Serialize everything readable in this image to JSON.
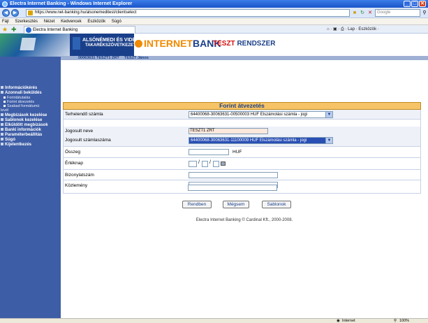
{
  "window": {
    "title": "Electra Internet Banking - Windows Internet Explorer",
    "minimize": "_",
    "maximize": "□",
    "close": "✕"
  },
  "browser": {
    "url": "https://www.net-banking.hu/alsonemeditest/clientselect",
    "search_placeholder": "Google",
    "menu": [
      "Fájl",
      "Szerkesztés",
      "Nézet",
      "Kedvencek",
      "Eszközök",
      "Súgó"
    ],
    "tab_title": "Electra Internet Banking",
    "tools": "⌂ · ▣ · ⎙ · Lap · Eszközök ·"
  },
  "bank": {
    "name_line1": "ALSÓNÉMEDI ÉS VIDÉKE",
    "name_line2": "TAKARÉKSZÖVETKEZET",
    "internet": "INTERNET",
    "bank_word": "BANK",
    "teszt": "TESZT",
    "rendszer": "RENDSZER",
    "account_strip": "00063631  TESZT1 ZRT",
    "user_strip": "TESZT János"
  },
  "sidebar": {
    "items": [
      {
        "label": "Információkérés",
        "bold": true
      },
      {
        "label": "Azonnali beküldés",
        "bold": true
      },
      {
        "label": "Forintátutalás",
        "bold": false,
        "sub": true
      },
      {
        "label": "Forint átvezetés",
        "bold": false,
        "sub": true
      },
      {
        "label": "Szabad formátumú",
        "bold": false,
        "sub": true
      },
      {
        "label": "levél",
        "bold": false,
        "sub": true,
        "cont": true
      },
      {
        "label": "Megbízások kezelése",
        "bold": true
      },
      {
        "label": "Sablonok kezelése",
        "bold": true
      },
      {
        "label": "Elküldött megbízások",
        "bold": true
      },
      {
        "label": "Banki információk",
        "bold": true
      },
      {
        "label": "Paraméterbeállítás",
        "bold": true
      },
      {
        "label": "Súgó",
        "bold": true
      },
      {
        "label": "Kijelentkezés",
        "bold": true
      }
    ]
  },
  "form": {
    "title": "Forint átvezetés",
    "debit_label": "Terhelendő számla",
    "debit_value": "64400068-30063631-00500003 HUF Elszámolási számla - jogi",
    "holder_label": "Jogosult neve",
    "holder_value": "TESZT1 ZRT",
    "account_label": "Jogosult számlaszáma",
    "account_value": "64400068-30063631-11100009 HUF Elszámolási számla - jogi",
    "amount_label": "Összeg",
    "amount_value": "",
    "currency": "HUF",
    "value_date_label": "Értéknap",
    "date_sep": "/",
    "ref_label": "Bizonylatszám",
    "ref_value": "",
    "comment_label": "Közlemény",
    "comment_value1": "",
    "comment_value2": ""
  },
  "buttons": {
    "ok": "Rendben",
    "cancel": "Mégsem",
    "templates": "Sablonok"
  },
  "footer": "Electra Internet Banking © Cardinal Kft., 2000-2008.",
  "status": {
    "zone": "Internet",
    "zoom": "100%"
  }
}
